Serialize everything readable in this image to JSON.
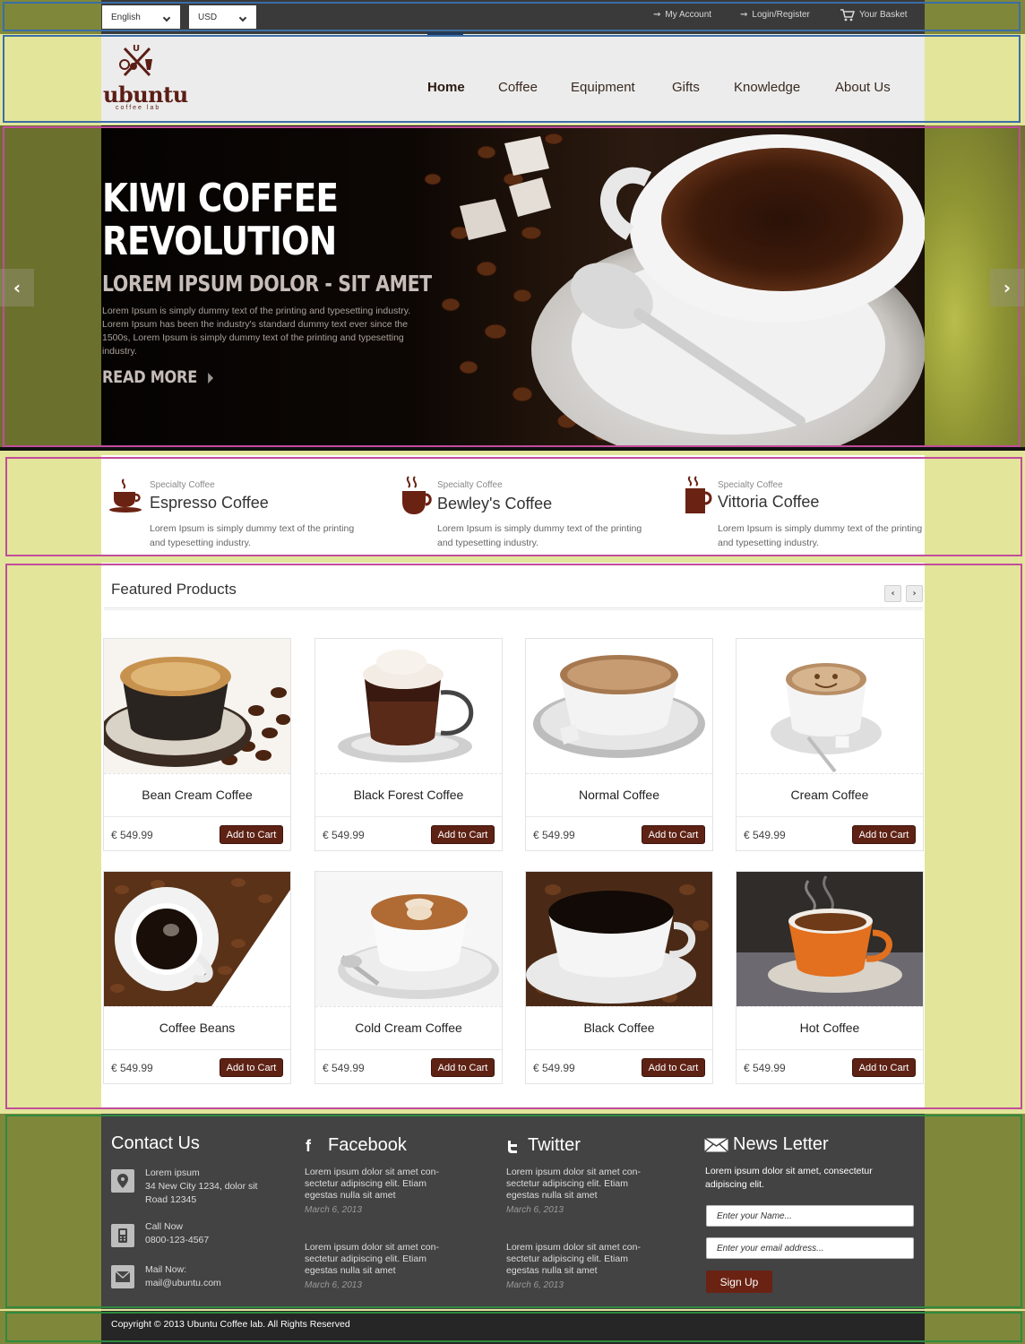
{
  "topbar": {
    "language": "English",
    "currency": "USD",
    "links": {
      "account": "My Account",
      "login": "Login/Register",
      "basket": "Your Basket"
    }
  },
  "brand": {
    "logo_word": "ubuntu",
    "logo_sub": "coffee lab"
  },
  "nav": {
    "items": [
      "Home",
      "Coffee",
      "Equipment",
      "Gifts",
      "Knowledge",
      "About Us"
    ],
    "active": "Home"
  },
  "hero": {
    "title_line1": "KIWI COFFEE",
    "title_line2": "REVOLUTION",
    "subtitle": "LOREM IPSUM DOLOR - SIT AMET",
    "body": "Lorem Ipsum is simply dummy text of the printing and typesetting industry. Lorem Ipsum has been the industry's standard dummy text ever since the 1500s, Lorem Ipsum is simply dummy text of the printing and typesetting industry.",
    "cta": "READ MORE"
  },
  "specialty": [
    {
      "kicker": "Specialty Coffee",
      "title": "Espresso Coffee",
      "desc": "Lorem Ipsum is simply dummy text of the printing and typesetting industry."
    },
    {
      "kicker": "Specialty Coffee",
      "title": "Bewley's Coffee",
      "desc": "Lorem Ipsum is simply dummy text of the printing and typesetting industry."
    },
    {
      "kicker": "Specialty Coffee",
      "title": "Vittoria Coffee",
      "desc": "Lorem Ipsum is simply dummy text of the printing and typesetting industry."
    }
  ],
  "featured": {
    "title": "Featured Products",
    "cart_label": "Add to Cart",
    "products": [
      {
        "name": "Bean Cream Coffee",
        "price": "€ 549.99"
      },
      {
        "name": "Black Forest Coffee",
        "price": "€ 549.99"
      },
      {
        "name": "Normal Coffee",
        "price": "€ 549.99"
      },
      {
        "name": "Cream Coffee",
        "price": "€ 549.99"
      },
      {
        "name": "Coffee Beans",
        "price": "€ 549.99"
      },
      {
        "name": "Cold Cream Coffee",
        "price": "€ 549.99"
      },
      {
        "name": "Black Coffee",
        "price": "€ 549.99"
      },
      {
        "name": "Hot Coffee",
        "price": "€ 549.99"
      }
    ]
  },
  "footer": {
    "contact": {
      "title": "Contact Us",
      "address_1": "Lorem ipsum",
      "address_2": "34 New City 1234, dolor sit",
      "address_3": "Road 12345",
      "call_label": "Call Now",
      "phone": "0800-123-4567",
      "mail_label": "Mail Now:",
      "email": "mail@ubuntu.com"
    },
    "facebook": {
      "title": "Facebook",
      "posts": [
        {
          "line1": "Lorem ipsum dolor sit amet con-",
          "line2": "sectetur adipiscing elit. Etiam",
          "line3": "egestas nulla sit amet",
          "date": "March 6, 2013"
        },
        {
          "line1": "Lorem ipsum dolor sit amet con-",
          "line2": "sectetur adipiscing elit. Etiam",
          "line3": "egestas nulla sit amet",
          "date": "March 6, 2013"
        }
      ]
    },
    "twitter": {
      "title": "Twitter",
      "posts": [
        {
          "line1": "Lorem ipsum dolor sit amet con-",
          "line2": "sectetur adipiscing elit. Etiam",
          "line3": "egestas nulla sit amet",
          "date": "March 6, 2013"
        },
        {
          "line1": "Lorem ipsum dolor sit amet con-",
          "line2": "sectetur adipiscing elit. Etiam",
          "line3": "egestas nulla sit amet",
          "date": "March 6, 2013"
        }
      ]
    },
    "newsletter": {
      "title": "News Letter",
      "text_1": "Lorem ipsum dolor sit amet, consectetur",
      "text_2": "adipiscing elit.",
      "name_placeholder": "Enter your Name...",
      "email_placeholder": "Enter your email address...",
      "button": "Sign Up"
    }
  },
  "copyright": "Copyright © 2013 Ubuntu Coffee lab. All Rights Reserved",
  "colors": {
    "brand": "#5b1d16",
    "button": "#5e2215",
    "footer_bg": "#434343",
    "side_fill": "#e2e59a"
  }
}
